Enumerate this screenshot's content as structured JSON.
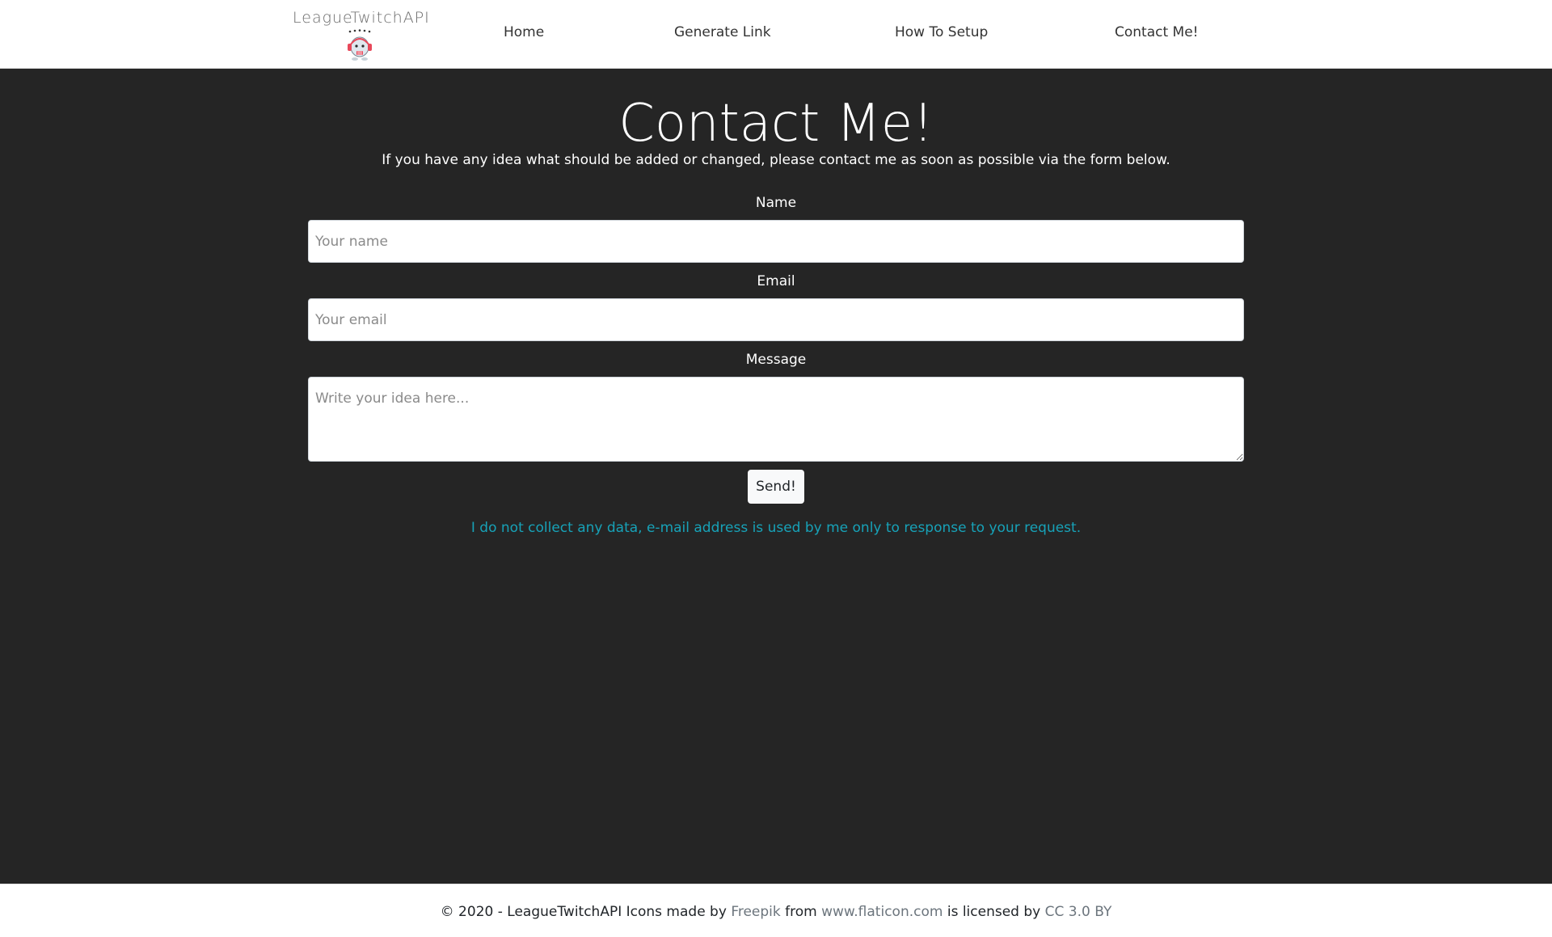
{
  "header": {
    "brand_name": "LeagueTwitchAPI",
    "logo_icon": "poro-mascot-icon",
    "nav": {
      "home": "Home",
      "generate_link": "Generate Link",
      "how_to_setup": "How To Setup",
      "contact": "Contact Me!"
    }
  },
  "main": {
    "title": "Contact Me!",
    "intro": "If you have any idea what should be added or changed, please contact me as soon as possible via the form below.",
    "form": {
      "name_label": "Name",
      "name_placeholder": "Your name",
      "name_value": "",
      "email_label": "Email",
      "email_placeholder": "Your email",
      "email_value": "",
      "message_label": "Message",
      "message_placeholder": "Write your idea here...",
      "message_value": "",
      "send_label": "Send!"
    },
    "privacy_note": "I do not collect any data, e-mail address is used by me only to response to your request."
  },
  "footer": {
    "copyright": "© 2020 - LeagueTwitchAPI",
    "icons_made_by": "Icons made by",
    "author": "Freepik",
    "from": "from",
    "source": "www.flaticon.com",
    "licensed_by": "is licensed by",
    "license": "CC 3.0 BY"
  },
  "colors": {
    "page_background": "#252525",
    "header_background": "#ffffff",
    "accent_info": "#17a2b8",
    "footer_link": "#6c757d"
  }
}
